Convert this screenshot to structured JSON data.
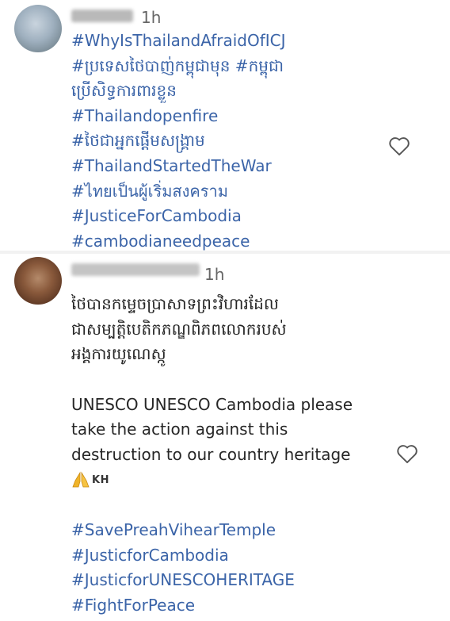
{
  "comments": [
    {
      "time": "1h",
      "lines": [
        "#WhyIsThailandAfraidOfICJ",
        "#ប្រទេសថៃបាញ់កម្ពុជាមុន #កម្ពុជា",
        "ប្រើសិទ្ធការពារខ្លួន",
        "#Thailandopenfire",
        "#ថៃជាអ្នកផ្តើមសង្គ្រាម",
        "#ThailandStartedTheWar",
        "#ไทยเป็นผู้เริ่มสงคราม",
        "#JusticeForCambodia",
        "#cambodianeedpeace"
      ],
      "like_icon": "heart-outline-icon"
    },
    {
      "time": "1h",
      "khmer_lines": [
        "ថៃបានកម្ទេចប្រាសាទព្រះវិហារដែល",
        "ជាសម្បត្តិបេតិកភណ្ឌពិភពលោករបស់",
        "អង្គការយូណេស្កូ"
      ],
      "english_lines": [
        "UNESCO UNESCO Cambodia please",
        "take the action against this",
        "destruction to our country heritage"
      ],
      "emoji_icon": "folded-hands-icon",
      "flag_text": "KH",
      "hashtags": [
        "#SavePreahVihearTemple",
        "#JusticforCambodia",
        "#JusticforUNESCOHERITAGE",
        "#FightForPeace"
      ],
      "like_icon": "heart-outline-icon"
    }
  ],
  "colors": {
    "hashtag": "#3b64a8",
    "text": "#262626",
    "muted": "#666666"
  }
}
